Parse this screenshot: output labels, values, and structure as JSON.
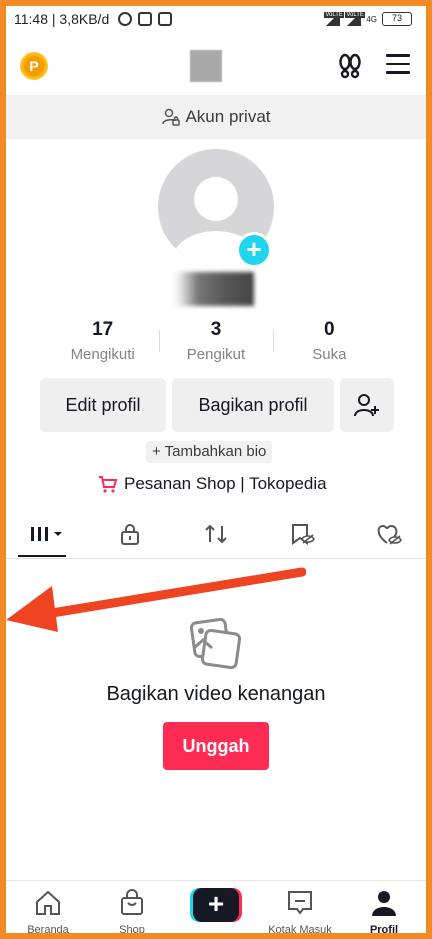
{
  "status_bar": {
    "time": "11:48",
    "network_speed": "3,8KB/d",
    "signal_label_1": "VoLTE",
    "signal_label_2": "VoLTE",
    "network_type": "4G",
    "battery": "73"
  },
  "header": {
    "coin_label": "P"
  },
  "private_bar": {
    "label": "Akun privat"
  },
  "stats": [
    {
      "value": "17",
      "label": "Mengikuti"
    },
    {
      "value": "3",
      "label": "Pengikut"
    },
    {
      "value": "0",
      "label": "Suka"
    }
  ],
  "buttons": {
    "edit_profile": "Edit profil",
    "share_profile": "Bagikan profil"
  },
  "bio": {
    "add_bio": "+ Tambahkan bio"
  },
  "shop": {
    "label": "Pesanan Shop | Tokopedia"
  },
  "empty_state": {
    "title": "Bagikan video kenangan",
    "upload_label": "Unggah"
  },
  "bottom_nav": {
    "home": "Beranda",
    "shop": "Shop",
    "inbox": "Kotak Masuk",
    "profile": "Profil"
  },
  "colors": {
    "frame": "#f28a26",
    "accent": "#fe2c55",
    "cyan": "#20d5ec",
    "arrow": "#ee4422"
  }
}
